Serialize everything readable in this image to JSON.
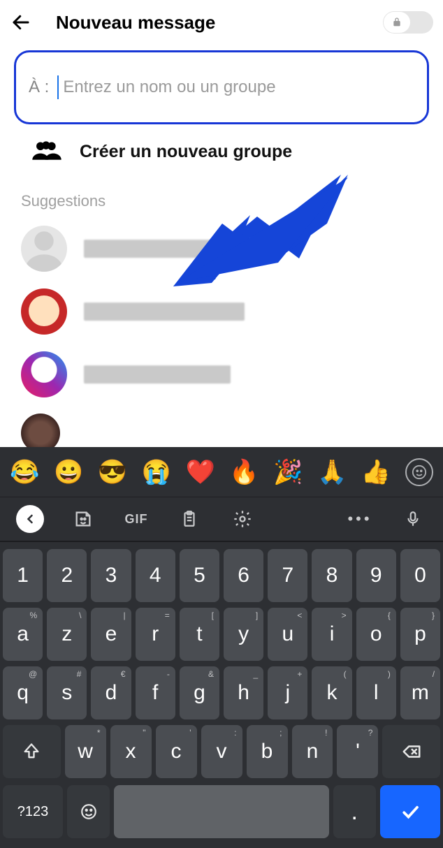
{
  "header": {
    "title": "Nouveau message"
  },
  "to": {
    "label": "À :",
    "placeholder": "Entrez un nom ou un groupe",
    "value": ""
  },
  "group": {
    "label": "Créer un nouveau groupe"
  },
  "suggestions": {
    "header": "Suggestions",
    "items": [
      {
        "name": ""
      },
      {
        "name": ""
      },
      {
        "name": ""
      },
      {
        "name": ""
      }
    ]
  },
  "emoji_row": [
    "😂",
    "😀",
    "😎",
    "😭",
    "❤️",
    "🔥",
    "🎉",
    "🙏",
    "👍"
  ],
  "toolbar": {
    "gif": "GIF",
    "more": "•••"
  },
  "keyboard": {
    "row1": [
      "1",
      "2",
      "3",
      "4",
      "5",
      "6",
      "7",
      "8",
      "9",
      "0"
    ],
    "row2": [
      {
        "k": "a",
        "s": "%"
      },
      {
        "k": "z",
        "s": "\\"
      },
      {
        "k": "e",
        "s": "|"
      },
      {
        "k": "r",
        "s": "="
      },
      {
        "k": "t",
        "s": "["
      },
      {
        "k": "y",
        "s": "]"
      },
      {
        "k": "u",
        "s": "<"
      },
      {
        "k": "i",
        "s": ">"
      },
      {
        "k": "o",
        "s": "{"
      },
      {
        "k": "p",
        "s": "}"
      }
    ],
    "row3": [
      {
        "k": "q",
        "s": "@"
      },
      {
        "k": "s",
        "s": "#"
      },
      {
        "k": "d",
        "s": "€"
      },
      {
        "k": "f",
        "s": "-"
      },
      {
        "k": "g",
        "s": "&"
      },
      {
        "k": "h",
        "s": "_"
      },
      {
        "k": "j",
        "s": "+"
      },
      {
        "k": "k",
        "s": "("
      },
      {
        "k": "l",
        "s": ")"
      },
      {
        "k": "m",
        "s": "/"
      }
    ],
    "row4": [
      {
        "k": "w",
        "s": "*"
      },
      {
        "k": "x",
        "s": "\""
      },
      {
        "k": "c",
        "s": "'"
      },
      {
        "k": "v",
        "s": ":"
      },
      {
        "k": "b",
        "s": ";"
      },
      {
        "k": "n",
        "s": "!"
      },
      {
        "k": "'",
        "s": "?"
      }
    ],
    "sym": "?123"
  }
}
